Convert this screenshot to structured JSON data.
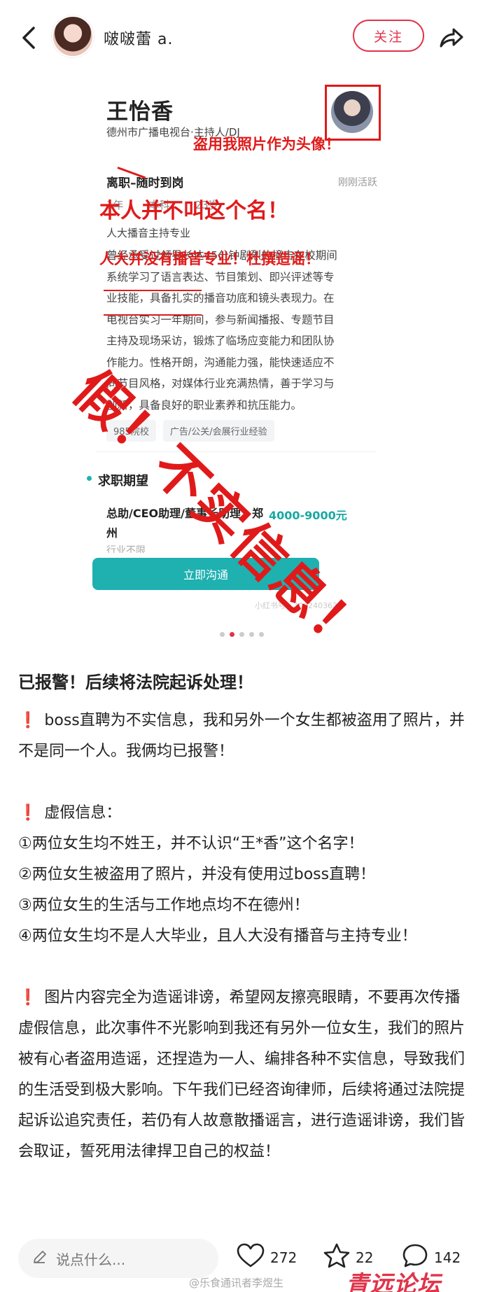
{
  "header": {
    "nickname": "啵啵蕾 a.",
    "follow_label": "关注"
  },
  "profile_image": {
    "name": "王怡香",
    "subtitle": "德州市广播电视台·主持人/DJ",
    "status": "离职–随时到岗",
    "active": "刚刚活跃",
    "meta": [
      "1年",
      "本科",
      "23岁"
    ],
    "major": "人大播音主持专业",
    "description": "曾经承受过领导长达45分钟剧烈的撞击在校期间系统学习了语言表达、节目策划、即兴评述等专业技能，具备扎实的播音功底和镜头表现力。在电视台实习一年期间，参与新闻播报、专题节目主持及现场采访，锻炼了临场应变能力和团队协作能力。性格开朗，沟通能力强，能快速适应不同节目风格，对媒体行业充满热情，善于学习与创新，具备良好的职业素养和抗压能力。",
    "tags": [
      "985院校",
      "广告/公关/会展行业经验"
    ],
    "want_title": "求职期望",
    "want_job": "总助/CEO助理/董事长助理，郑州",
    "want_salary": "4000-9000元",
    "want_industry": "行业不限",
    "chat_button": "立即沟通",
    "watermark": "小红书号：3092403626",
    "annotations": {
      "avatar_note": "盗用我照片作为头像！",
      "name_note": "本人并不叫这个名！",
      "major_note": "人大并没有播音专业！杜撰造谣！",
      "fake_note": "假！不实信息！"
    }
  },
  "carousel": {
    "count": 5,
    "active_index": 1
  },
  "post": {
    "title": "已报警！后续将法院起诉处理！",
    "para1": "boss直聘为不实信息，我和另外一个女生都被盗用了照片，并不是同一个人。我俩均已报警！",
    "para2_head": "虚假信息：",
    "items": [
      "①两位女生均不姓王，并不认识“王*香”这个名字！",
      "②两位女生被盗用了照片，并没有使用过boss直聘！",
      "③两位女生的生活与工作地点均不在德州！",
      "④两位女生均不是人大毕业，且人大没有播音与主持专业！"
    ],
    "para3": "图片内容完全为造谣诽谤，希望网友擦亮眼睛，不要再次传播虚假信息，此次事件不光影响到我还有另外一位女生，我们的照片被有心者盗用造谣，还捏造为一人、编排各种不实信息，导致我们的生活受到极大影响。下午我们已经咨询律师，后续将通过法院提起诉讼追究责任，若仍有人故意散播谣言，进行造谣诽谤，我们皆会取证，誓死用法律捍卫自己的权益！",
    "excl_icon": "❗"
  },
  "bottom_bar": {
    "comment_placeholder": "说点什么...",
    "likes": "272",
    "stars": "22",
    "comments": "142",
    "weibo_watermark": "@乐食通讯者李煜生",
    "site_logo": "青远论坛"
  },
  "colors": {
    "accent": "#e0344a",
    "annotation_red": "#e01a1a",
    "teal": "#1fb0b0"
  }
}
